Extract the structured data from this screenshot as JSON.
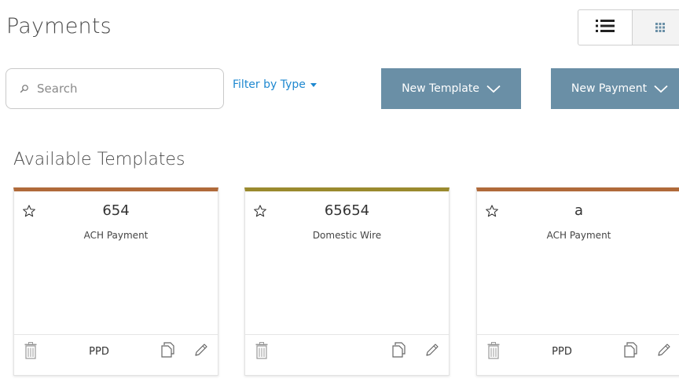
{
  "page": {
    "title": "Payments"
  },
  "toolbar": {
    "search_placeholder": "Search",
    "search_value": "",
    "filter_label": "Filter by Type",
    "new_template_label": "New Template",
    "new_payment_label": "New Payment"
  },
  "view_toggle": {
    "options": [
      "list-view-icon",
      "grid-view-icon"
    ],
    "selected": "grid-view-icon"
  },
  "colors": {
    "action_button": "#6a8fa6",
    "link": "#1e88d0",
    "ach_accent": "#b06a3a",
    "wire_accent": "#9a8a2e"
  },
  "templates": {
    "section_title": "Available Templates",
    "cards": [
      {
        "name": "654",
        "type": "ACH Payment",
        "sec_code": "PPD",
        "accent": "#b06a3a"
      },
      {
        "name": "65654",
        "type": "Domestic Wire",
        "sec_code": "",
        "accent": "#9a8a2e"
      },
      {
        "name": "a",
        "type": "ACH Payment",
        "sec_code": "PPD",
        "accent": "#b06a3a"
      }
    ]
  }
}
